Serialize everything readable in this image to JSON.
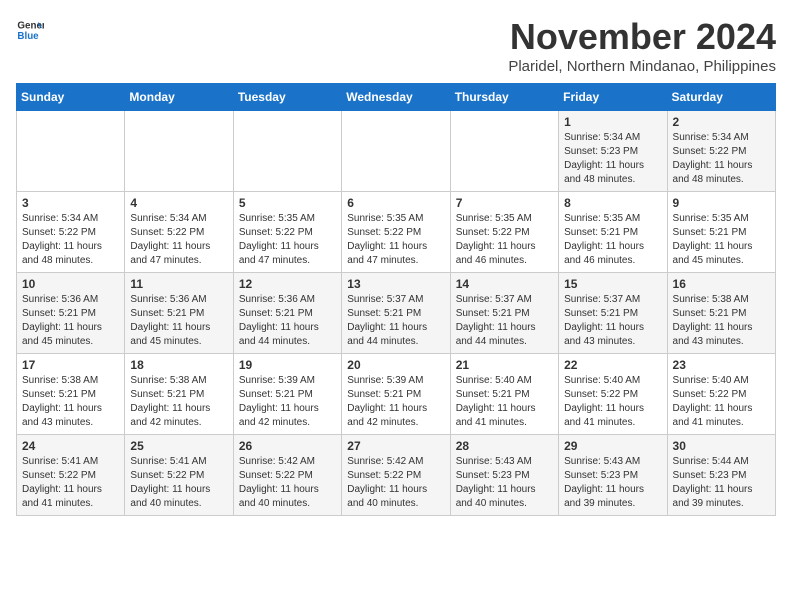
{
  "logo": {
    "line1": "General",
    "line2": "Blue"
  },
  "title": "November 2024",
  "location": "Plaridel, Northern Mindanao, Philippines",
  "weekdays": [
    "Sunday",
    "Monday",
    "Tuesday",
    "Wednesday",
    "Thursday",
    "Friday",
    "Saturday"
  ],
  "weeks": [
    [
      {
        "day": "",
        "info": ""
      },
      {
        "day": "",
        "info": ""
      },
      {
        "day": "",
        "info": ""
      },
      {
        "day": "",
        "info": ""
      },
      {
        "day": "",
        "info": ""
      },
      {
        "day": "1",
        "info": "Sunrise: 5:34 AM\nSunset: 5:23 PM\nDaylight: 11 hours and 48 minutes."
      },
      {
        "day": "2",
        "info": "Sunrise: 5:34 AM\nSunset: 5:22 PM\nDaylight: 11 hours and 48 minutes."
      }
    ],
    [
      {
        "day": "3",
        "info": "Sunrise: 5:34 AM\nSunset: 5:22 PM\nDaylight: 11 hours and 48 minutes."
      },
      {
        "day": "4",
        "info": "Sunrise: 5:34 AM\nSunset: 5:22 PM\nDaylight: 11 hours and 47 minutes."
      },
      {
        "day": "5",
        "info": "Sunrise: 5:35 AM\nSunset: 5:22 PM\nDaylight: 11 hours and 47 minutes."
      },
      {
        "day": "6",
        "info": "Sunrise: 5:35 AM\nSunset: 5:22 PM\nDaylight: 11 hours and 47 minutes."
      },
      {
        "day": "7",
        "info": "Sunrise: 5:35 AM\nSunset: 5:22 PM\nDaylight: 11 hours and 46 minutes."
      },
      {
        "day": "8",
        "info": "Sunrise: 5:35 AM\nSunset: 5:21 PM\nDaylight: 11 hours and 46 minutes."
      },
      {
        "day": "9",
        "info": "Sunrise: 5:35 AM\nSunset: 5:21 PM\nDaylight: 11 hours and 45 minutes."
      }
    ],
    [
      {
        "day": "10",
        "info": "Sunrise: 5:36 AM\nSunset: 5:21 PM\nDaylight: 11 hours and 45 minutes."
      },
      {
        "day": "11",
        "info": "Sunrise: 5:36 AM\nSunset: 5:21 PM\nDaylight: 11 hours and 45 minutes."
      },
      {
        "day": "12",
        "info": "Sunrise: 5:36 AM\nSunset: 5:21 PM\nDaylight: 11 hours and 44 minutes."
      },
      {
        "day": "13",
        "info": "Sunrise: 5:37 AM\nSunset: 5:21 PM\nDaylight: 11 hours and 44 minutes."
      },
      {
        "day": "14",
        "info": "Sunrise: 5:37 AM\nSunset: 5:21 PM\nDaylight: 11 hours and 44 minutes."
      },
      {
        "day": "15",
        "info": "Sunrise: 5:37 AM\nSunset: 5:21 PM\nDaylight: 11 hours and 43 minutes."
      },
      {
        "day": "16",
        "info": "Sunrise: 5:38 AM\nSunset: 5:21 PM\nDaylight: 11 hours and 43 minutes."
      }
    ],
    [
      {
        "day": "17",
        "info": "Sunrise: 5:38 AM\nSunset: 5:21 PM\nDaylight: 11 hours and 43 minutes."
      },
      {
        "day": "18",
        "info": "Sunrise: 5:38 AM\nSunset: 5:21 PM\nDaylight: 11 hours and 42 minutes."
      },
      {
        "day": "19",
        "info": "Sunrise: 5:39 AM\nSunset: 5:21 PM\nDaylight: 11 hours and 42 minutes."
      },
      {
        "day": "20",
        "info": "Sunrise: 5:39 AM\nSunset: 5:21 PM\nDaylight: 11 hours and 42 minutes."
      },
      {
        "day": "21",
        "info": "Sunrise: 5:40 AM\nSunset: 5:21 PM\nDaylight: 11 hours and 41 minutes."
      },
      {
        "day": "22",
        "info": "Sunrise: 5:40 AM\nSunset: 5:22 PM\nDaylight: 11 hours and 41 minutes."
      },
      {
        "day": "23",
        "info": "Sunrise: 5:40 AM\nSunset: 5:22 PM\nDaylight: 11 hours and 41 minutes."
      }
    ],
    [
      {
        "day": "24",
        "info": "Sunrise: 5:41 AM\nSunset: 5:22 PM\nDaylight: 11 hours and 41 minutes."
      },
      {
        "day": "25",
        "info": "Sunrise: 5:41 AM\nSunset: 5:22 PM\nDaylight: 11 hours and 40 minutes."
      },
      {
        "day": "26",
        "info": "Sunrise: 5:42 AM\nSunset: 5:22 PM\nDaylight: 11 hours and 40 minutes."
      },
      {
        "day": "27",
        "info": "Sunrise: 5:42 AM\nSunset: 5:22 PM\nDaylight: 11 hours and 40 minutes."
      },
      {
        "day": "28",
        "info": "Sunrise: 5:43 AM\nSunset: 5:23 PM\nDaylight: 11 hours and 40 minutes."
      },
      {
        "day": "29",
        "info": "Sunrise: 5:43 AM\nSunset: 5:23 PM\nDaylight: 11 hours and 39 minutes."
      },
      {
        "day": "30",
        "info": "Sunrise: 5:44 AM\nSunset: 5:23 PM\nDaylight: 11 hours and 39 minutes."
      }
    ]
  ]
}
